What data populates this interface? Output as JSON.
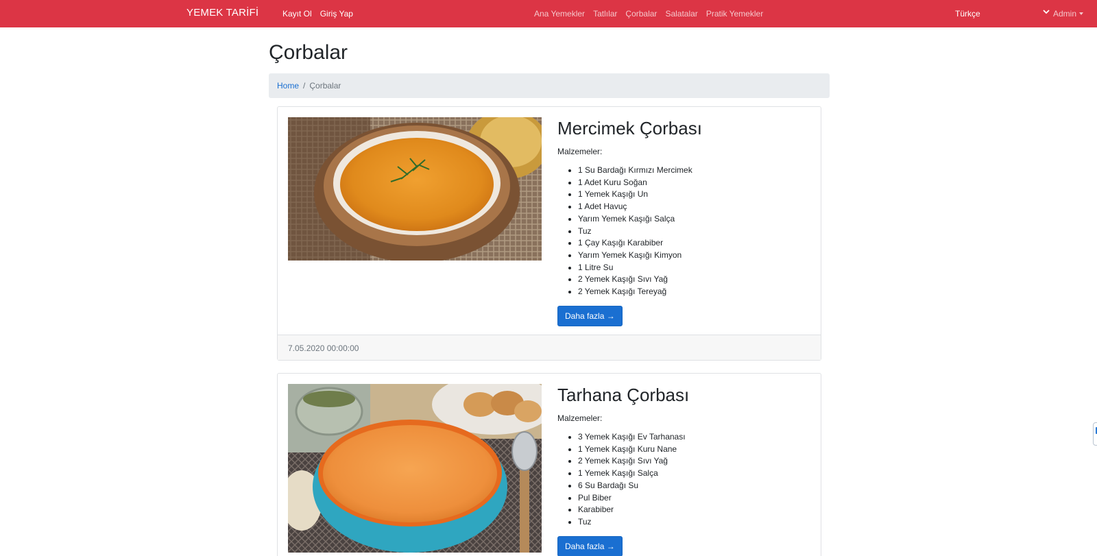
{
  "navbar": {
    "brand": "YEMEK TARİFİ",
    "auth_links": [
      {
        "label": "Kayıt Ol"
      },
      {
        "label": "Giriş Yap"
      }
    ],
    "categories": [
      {
        "label": "Ana Yemekler"
      },
      {
        "label": "Tatlılar"
      },
      {
        "label": "Çorbalar"
      },
      {
        "label": "Salatalar"
      },
      {
        "label": "Pratik Yemekler"
      }
    ],
    "language": "Türkçe",
    "admin": "Admin",
    "color": "#dc3545"
  },
  "page": {
    "title": "Çorbalar",
    "breadcrumb": {
      "home": "Home",
      "separator": "/",
      "current": "Çorbalar"
    }
  },
  "recipes": [
    {
      "title": "Mercimek Çorbası",
      "ingredients_label": "Malzemeler:",
      "ingredients": [
        "1 Su Bardağı Kırmızı Mercimek",
        "1 Adet Kuru Soğan",
        "1 Yemek Kaşığı Un",
        "1 Adet Havuç",
        "Yarım Yemek Kaşığı Salça",
        "Tuz",
        "1 Çay Kaşığı Karabiber",
        "Yarım Yemek Kaşığı Kimyon",
        "1 Litre Su",
        "2 Yemek Kaşığı Sıvı Yağ",
        "2 Yemek Kaşığı Tereyağ"
      ],
      "button": "Daha fazla →",
      "date": "7.05.2020 00:00:00"
    },
    {
      "title": "Tarhana Çorbası",
      "ingredients_label": "Malzemeler:",
      "ingredients": [
        "3 Yemek Kaşığı Ev Tarhanası",
        "1 Yemek Kaşığı Kuru Nane",
        "2 Yemek Kaşığı Sıvı Yağ",
        "1 Yemek Kaşığı Salça",
        "6 Su Bardağı Su",
        "Pul Biber",
        "Karabiber",
        "Tuz"
      ],
      "button": "Daha fazla →"
    }
  ],
  "colors": {
    "primary": "#1a6fd1",
    "breadcrumb_bg": "#e9ecef"
  }
}
